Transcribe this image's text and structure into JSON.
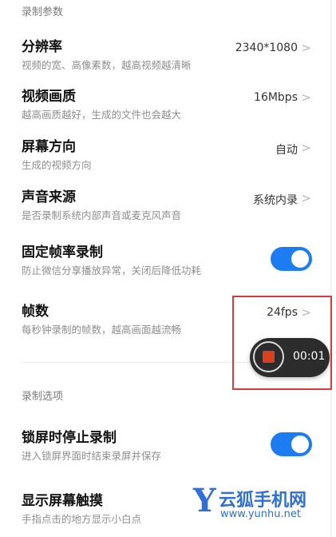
{
  "sections": {
    "record_params": "录制参数",
    "record_options": "录制选项"
  },
  "rows": {
    "resolution": {
      "title": "分辨率",
      "subtitle": "视频的宽、高像素数，越高视频越清晰",
      "value": "2340*1080"
    },
    "quality": {
      "title": "视频画质",
      "subtitle": "越高画质越好，生成的文件也会越大",
      "value": "16Mbps"
    },
    "orientation": {
      "title": "屏幕方向",
      "subtitle": "生成的视频方向",
      "value": "自动"
    },
    "audio_source": {
      "title": "声音来源",
      "subtitle": "是否录制系统内部声音或麦克风声音",
      "value": "系统内录"
    },
    "fixed_framerate": {
      "title": "固定帧率录制",
      "subtitle": "防止微信分享播放异常，关闭后降低功耗",
      "enabled": true
    },
    "framerate": {
      "title": "帧数",
      "subtitle": "每秒钟录制的帧数，越高画面越流畅",
      "value": "24fps"
    },
    "stop_on_lock": {
      "title": "锁屏时停止录制",
      "subtitle": "进入锁屏界面时结束录屏并保存",
      "enabled": true
    },
    "show_touches": {
      "title": "显示屏幕触摸",
      "subtitle": "手指点击的地方显示小白点"
    }
  },
  "recorder": {
    "elapsed": "00:01",
    "stop_icon": "stop-icon"
  },
  "watermark": {
    "logo_letter": "Y",
    "site_name": "云狐手机网",
    "url": "www.yunhu.net"
  },
  "colors": {
    "accent": "#1d7cf2",
    "highlight": "#d93a3a",
    "record": "#d8401f"
  }
}
